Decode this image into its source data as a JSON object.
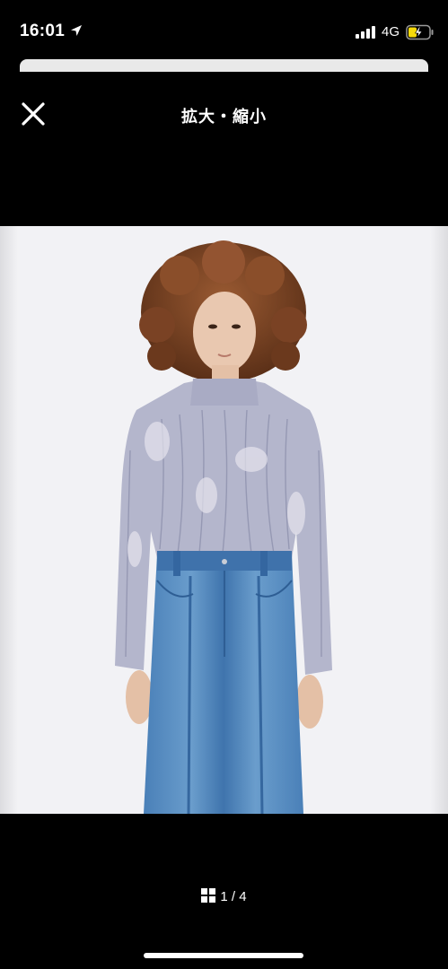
{
  "status_bar": {
    "time": "16:01",
    "network": "4G",
    "location_icon": "location-arrow-icon",
    "signal_icon": "cellular-signal-icon",
    "battery_icon": "battery-charging-icon",
    "battery_color": "#f5d90a"
  },
  "header": {
    "title": "拡大・縮小",
    "close_icon": "close-icon"
  },
  "photo": {
    "background_color": "#e6e6ea"
  },
  "pager": {
    "icon": "grid-icon",
    "text": "1 / 4"
  }
}
